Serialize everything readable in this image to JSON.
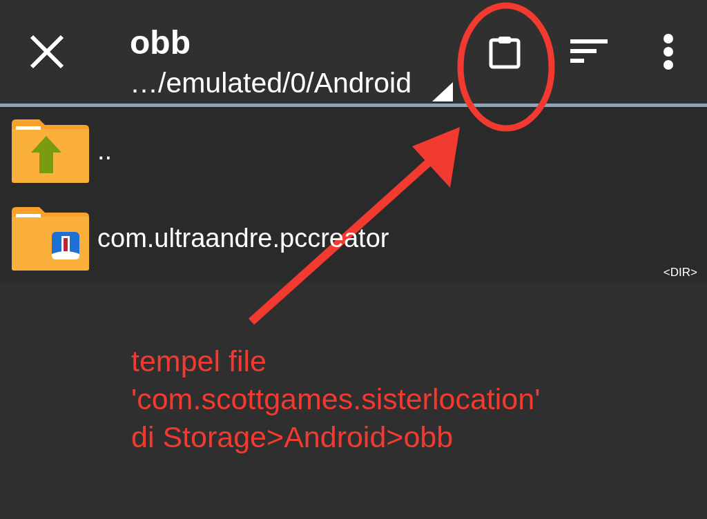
{
  "app_bar": {
    "title": "obb",
    "path": "…/emulated/0/Android"
  },
  "files": [
    {
      "name": "..",
      "kind": "parent"
    },
    {
      "name": "com.ultraandre.pccreator",
      "kind": "app",
      "tag": "<DIR>"
    }
  ],
  "annotation": {
    "lines": [
      "tempel file",
      "'com.scottgames.sisterlocation'",
      "di Storage>Android>obb"
    ]
  }
}
